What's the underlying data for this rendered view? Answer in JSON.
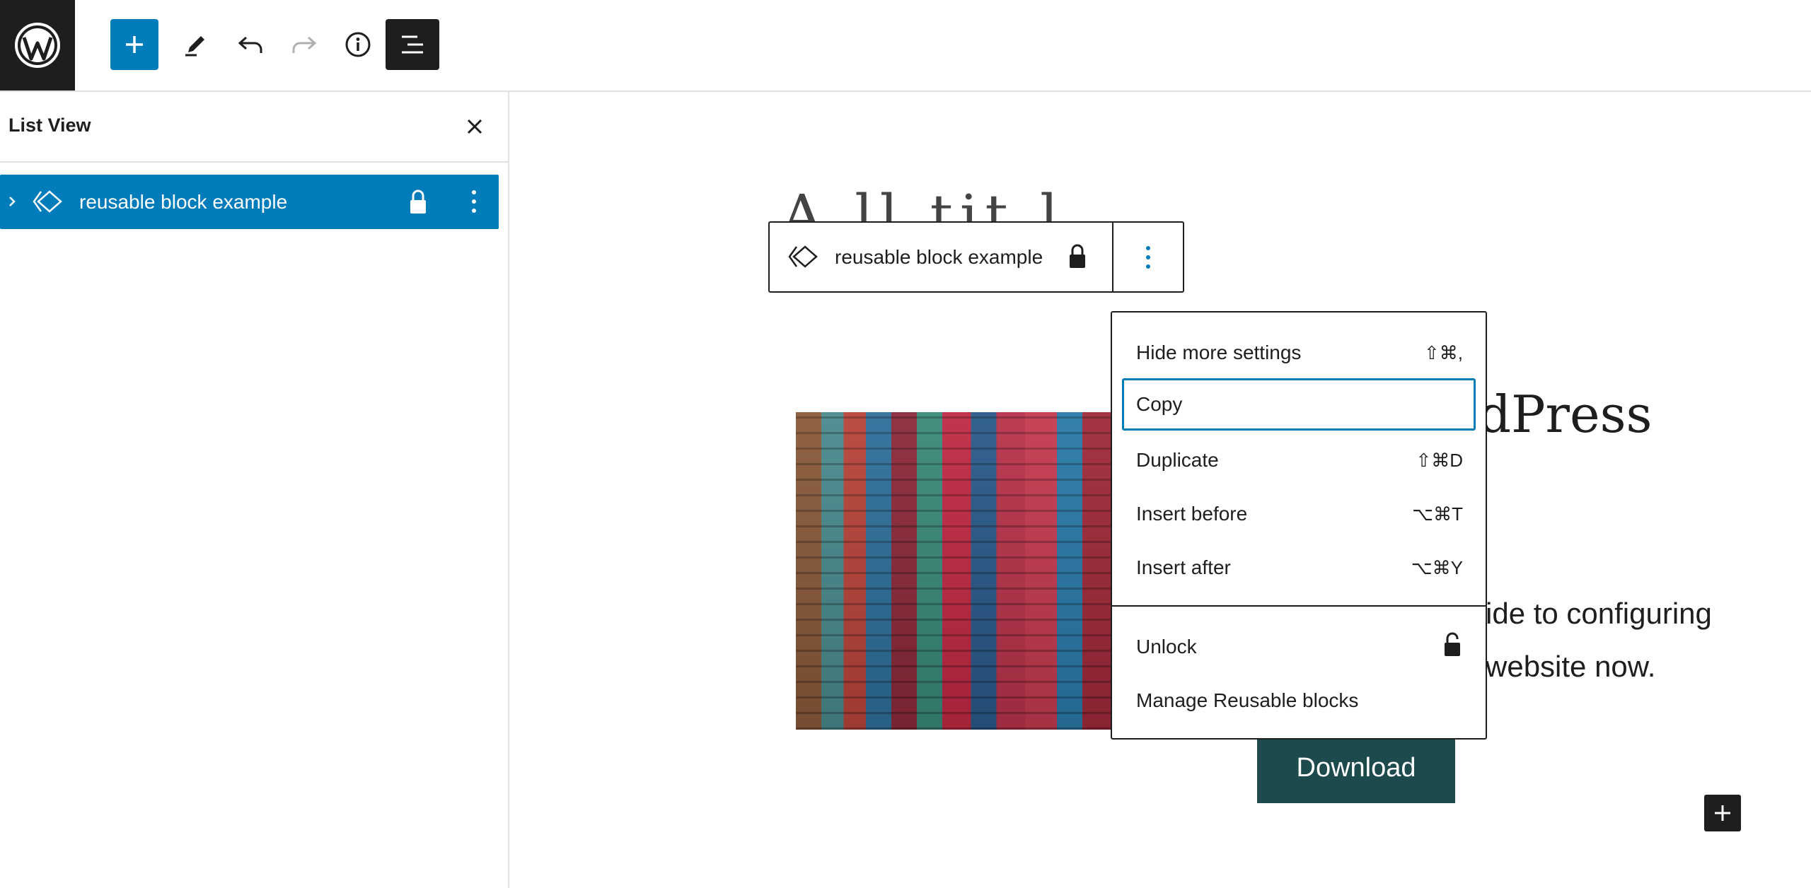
{
  "toolbar": {
    "add_label": "Add block",
    "edit_label": "Tools",
    "undo_label": "Undo",
    "redo_label": "Redo",
    "info_label": "Details",
    "listview_label": "List View"
  },
  "sidebar": {
    "title": "List View",
    "rows": [
      {
        "label": "reusable block example",
        "locked": true
      }
    ]
  },
  "canvas": {
    "partial_title": "A ll tit l",
    "heading_fragment": "dPress",
    "paragraph_lines": [
      "ide to configuring",
      "website now."
    ],
    "download_label": "Download"
  },
  "block_toolbar": {
    "label": "reusable block example"
  },
  "menu": {
    "items": [
      {
        "label": "Hide more settings",
        "shortcut": "⇧⌘,"
      },
      {
        "label": "Copy",
        "shortcut": ""
      },
      {
        "label": "Duplicate",
        "shortcut": "⇧⌘D"
      },
      {
        "label": "Insert before",
        "shortcut": "⌥⌘T"
      },
      {
        "label": "Insert after",
        "shortcut": "⌥⌘Y"
      }
    ],
    "group2": [
      {
        "label": "Unlock"
      },
      {
        "label": "Manage Reusable blocks"
      }
    ]
  },
  "colors": {
    "accent": "#007cba",
    "dark": "#1e1e1e",
    "button_bg": "#1d4a4d"
  }
}
